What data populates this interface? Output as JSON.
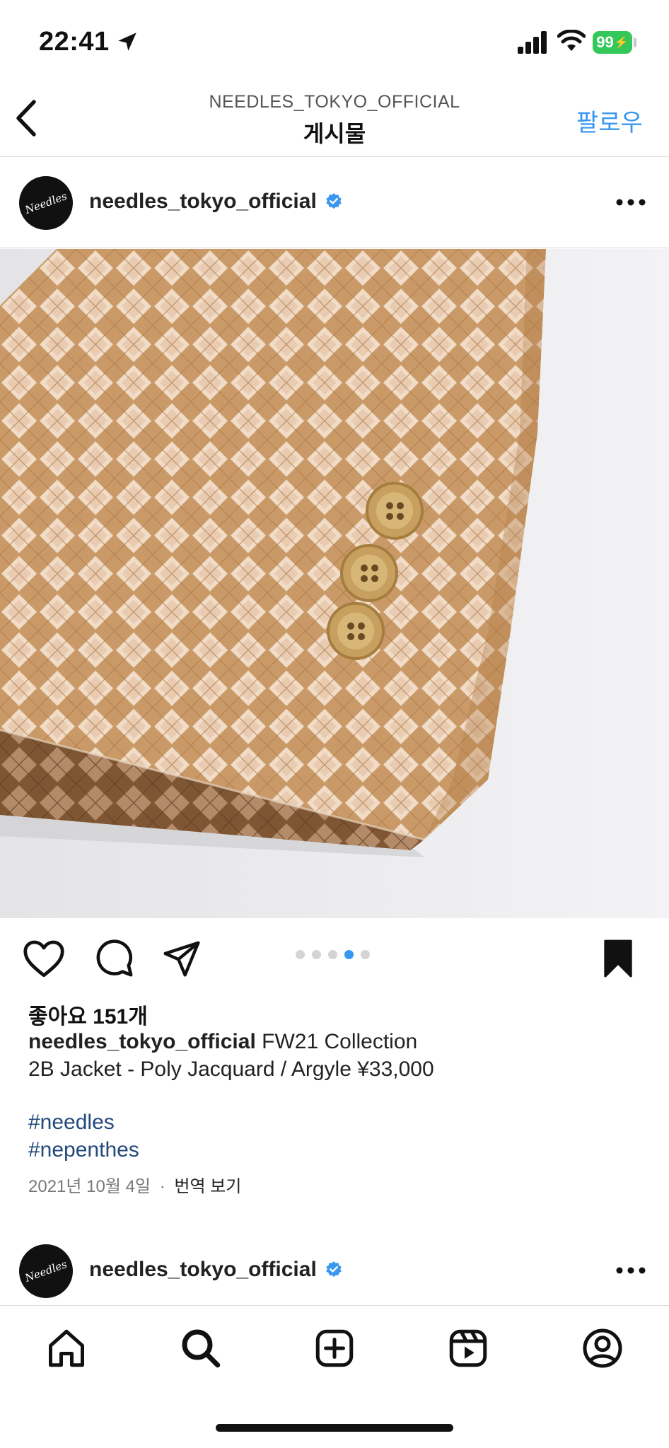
{
  "status_bar": {
    "time": "22:41",
    "battery": "99"
  },
  "nav": {
    "subtitle": "NEEDLES_TOKYO_OFFICIAL",
    "title": "게시물",
    "follow_label": "팔로우"
  },
  "post": {
    "username": "needles_tokyo_official",
    "avatar_text": "Needles",
    "carousel": {
      "count": 5,
      "active_index": 3
    },
    "likes": "좋아요 151개",
    "caption_line1": "FW21 Collection",
    "caption_line2": "2B Jacket - Poly Jacquard / Argyle ¥33,000",
    "hashtags": [
      "#needles",
      "#nepenthes"
    ],
    "date": "2021년 10월 4일",
    "separator": "·",
    "translate_label": "번역 보기",
    "saved": true
  },
  "next_post": {
    "username": "needles_tokyo_official",
    "avatar_text": "Needles"
  },
  "tab_bar": {
    "items": [
      "home-icon",
      "search-icon",
      "create-icon",
      "reels-icon",
      "profile-icon"
    ]
  },
  "colors": {
    "accent": "#3797f0",
    "hashtag": "#244a7c",
    "battery": "#34c759",
    "verified": "#3897f0",
    "fabric_light": "#f0d9c3",
    "fabric_dark": "#c58f58"
  }
}
